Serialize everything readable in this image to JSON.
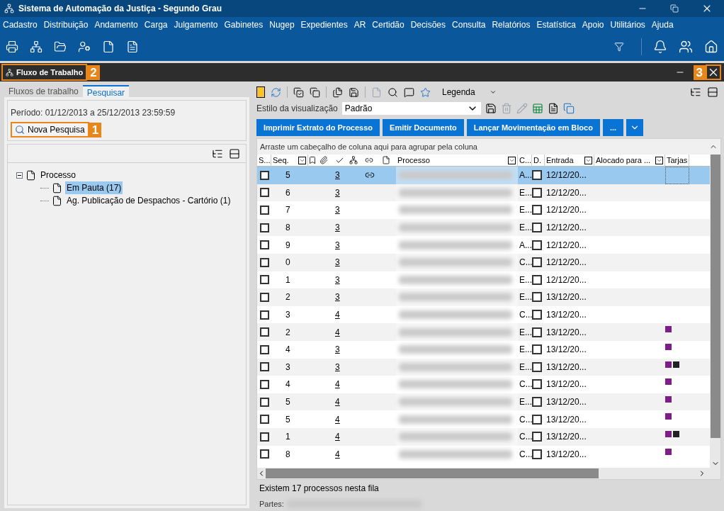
{
  "window": {
    "title": "Sistema de Automação da Justiça - Segundo Grau"
  },
  "menu": [
    "Cadastro",
    "Distribuição",
    "Andamento",
    "Carga",
    "Julgamento",
    "Gabinetes",
    "Nugep",
    "Expedientes",
    "AR",
    "Certidão",
    "Decisões",
    "Consulta",
    "Relatórios",
    "Estatística",
    "Apoio",
    "Utilitários",
    "Ajuda"
  ],
  "panel": {
    "title": "Fluxo de Trabalho",
    "title_callout": "2",
    "close_callout": "3"
  },
  "left": {
    "tabs": [
      {
        "label": "Fluxos de trabalho",
        "selected": false
      },
      {
        "label": "Pesquisar",
        "selected": true
      }
    ],
    "period": "Período: 01/12/2013 a 25/12/2013 23:59:59",
    "search_button": "Nova Pesquisa",
    "search_callout": "1",
    "tree": [
      {
        "label": "Processo",
        "expanded": true,
        "selected": false,
        "children": [
          {
            "label": "Em Pauta (17)",
            "selected": true
          },
          {
            "label": "Ag. Publicação de Despachos - Cartório (1)",
            "selected": false
          }
        ]
      }
    ]
  },
  "toolbar": {
    "legend": "Legenda",
    "view_style_label": "Estilo da visualização",
    "view_style": "Padrão"
  },
  "actions": [
    "Imprimir Extrato do Processo",
    "Emitir Documento",
    "Lançar Movimentação em Bloco",
    "..."
  ],
  "table": {
    "group_hint": "Arraste um cabeçalho de coluna aqui para agrupar pela coluna",
    "columns": [
      "S...",
      "Seq.",
      "Processo",
      "C...",
      "D.",
      "Entrada",
      "Alocado para ...",
      "Tarjas"
    ],
    "rows": [
      {
        "seq": "5",
        "count": "3",
        "linked": true,
        "c": "A...",
        "checked": false,
        "entrada": "12/12/20...",
        "tags": [],
        "selected": true
      },
      {
        "seq": "6",
        "count": "3",
        "linked": false,
        "c": "E...",
        "checked": false,
        "entrada": "12/12/20...",
        "tags": [],
        "selected": false
      },
      {
        "seq": "7",
        "count": "3",
        "linked": false,
        "c": "E...",
        "checked": false,
        "entrada": "12/12/20...",
        "tags": [],
        "selected": false
      },
      {
        "seq": "8",
        "count": "3",
        "linked": false,
        "c": "E...",
        "checked": false,
        "entrada": "12/12/20...",
        "tags": [],
        "selected": false
      },
      {
        "seq": "9",
        "count": "3",
        "linked": false,
        "c": "A...",
        "checked": false,
        "entrada": "12/12/20...",
        "tags": [],
        "selected": false
      },
      {
        "seq": "0",
        "count": "3",
        "linked": false,
        "c": "C...",
        "checked": false,
        "entrada": "12/12/20...",
        "tags": [],
        "selected": false
      },
      {
        "seq": "1",
        "count": "3",
        "linked": false,
        "c": "E...",
        "checked": false,
        "entrada": "12/12/20...",
        "tags": [],
        "selected": false
      },
      {
        "seq": "2",
        "count": "3",
        "linked": false,
        "c": "E...",
        "checked": false,
        "entrada": "13/12/20...",
        "tags": [],
        "selected": false
      },
      {
        "seq": "3",
        "count": "4",
        "linked": false,
        "c": "C...",
        "checked": false,
        "entrada": "13/12/20...",
        "tags": [],
        "selected": false
      },
      {
        "seq": "2",
        "count": "4",
        "linked": false,
        "c": "E...",
        "checked": false,
        "entrada": "13/12/20...",
        "tags": [
          {
            "color": "#7b1f86"
          }
        ],
        "selected": false
      },
      {
        "seq": "4",
        "count": "3",
        "linked": false,
        "c": "E...",
        "checked": false,
        "entrada": "13/12/20...",
        "tags": [
          {
            "color": "#7b1f86"
          }
        ],
        "selected": false
      },
      {
        "seq": "3",
        "count": "3",
        "linked": false,
        "c": "E...",
        "checked": false,
        "entrada": "13/12/20...",
        "tags": [
          {
            "color": "#7b1f86"
          },
          {
            "color": "#222222"
          }
        ],
        "selected": false
      },
      {
        "seq": "4",
        "count": "4",
        "linked": false,
        "c": "C...",
        "checked": false,
        "entrada": "13/12/20...",
        "tags": [
          {
            "color": "#7b1f86"
          }
        ],
        "selected": false
      },
      {
        "seq": "5",
        "count": "4",
        "linked": false,
        "c": "E...",
        "checked": false,
        "entrada": "13/12/20...",
        "tags": [
          {
            "color": "#7b1f86"
          }
        ],
        "selected": false
      },
      {
        "seq": "5",
        "count": "4",
        "linked": false,
        "c": "C...",
        "checked": false,
        "entrada": "13/12/20...",
        "tags": [
          {
            "color": "#7b1f86"
          }
        ],
        "selected": false
      },
      {
        "seq": "1",
        "count": "4",
        "linked": false,
        "c": "C...",
        "checked": false,
        "entrada": "13/12/20...",
        "tags": [
          {
            "color": "#7b1f86"
          },
          {
            "color": "#222222"
          }
        ],
        "selected": false
      },
      {
        "seq": "8",
        "count": "4",
        "linked": false,
        "c": "C...",
        "checked": false,
        "entrada": "13/12/20...",
        "tags": [
          {
            "color": "#7b1f86"
          }
        ],
        "selected": false
      }
    ]
  },
  "status": "Existem 17 processos nesta fila",
  "parties_label": "Partes:"
}
